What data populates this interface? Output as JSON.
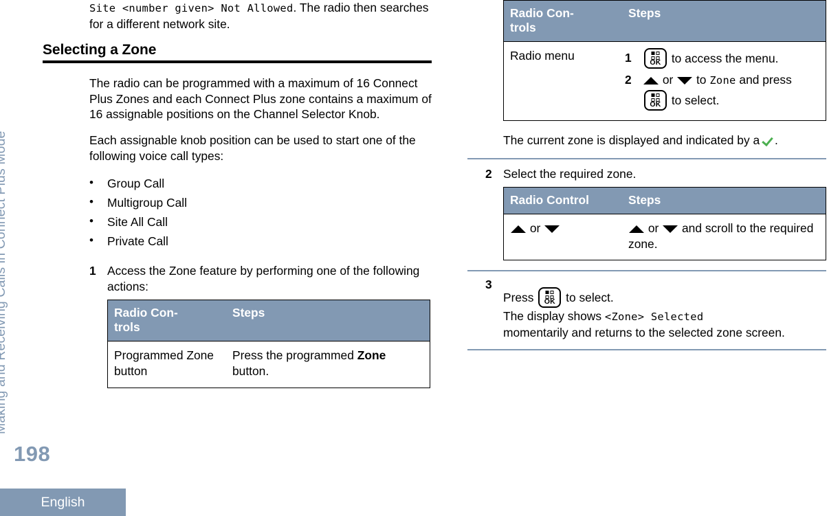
{
  "sidebar": {
    "running_head": "Making and Receiving Calls in Connect Plus Mode",
    "page_number": "198",
    "language_tab": "English"
  },
  "colors": {
    "accent_blue": "#8299b3",
    "table_header_bg": "#8299b3",
    "check_green": "#4caf50",
    "rule_black": "#000000"
  },
  "left_column": {
    "continued_paragraph": {
      "mono_text": "Site <number given> Not Allowed",
      "rest": ". The radio then searches for a different network site."
    },
    "heading": "Selecting a Zone",
    "paragraph_1": "The radio can be programmed with a maximum of 16 Connect Plus Zones and each Connect Plus zone contains a maximum of 16 assignable positions on the Channel Selector Knob.",
    "paragraph_2": "Each assignable knob position can be used to start one of the following voice call types:",
    "call_types": [
      "Group Call",
      "Multigroup Call",
      "Site All Call",
      "Private Call"
    ],
    "step_1": {
      "number": "1",
      "text": "Access the Zone feature by performing one of the following actions:"
    },
    "table_zone_access": {
      "headers": [
        "Radio Con-\ntrols",
        "Steps"
      ],
      "header_col_1": "Radio Con-",
      "header_col_1_line2": "trols",
      "header_col_2": "Steps",
      "rows": [
        {
          "control": "Programmed Zone button",
          "step_prefix": "Press the programmed ",
          "step_bold": "Zone",
          "step_suffix": " button."
        }
      ]
    }
  },
  "right_column": {
    "table_radio_menu": {
      "header_col_1": "Radio Con-",
      "header_col_1_line2": "trols",
      "header_col_2": "Steps",
      "row_control": "Radio menu",
      "substeps": [
        {
          "number": "1",
          "icon": "ok-key-icon",
          "text": " to access the menu."
        },
        {
          "number": "2",
          "text_before": " or ",
          "text_middle": " to ",
          "mono": "Zone",
          "text_after": " and press",
          "text_tail": " to select."
        }
      ]
    },
    "note_after_table": {
      "text_before": "The current zone is displayed and indicated by a ",
      "icon": "green-check-icon",
      "text_after": "."
    },
    "step_2": {
      "number": "2",
      "text": "Select the required zone."
    },
    "table_select_zone": {
      "header_col_1": "Radio Control",
      "header_col_2": "Steps",
      "row_control_or": "or",
      "row_step_or": "or",
      "row_step_text": " and scroll to the required zone."
    },
    "step_3": {
      "number": "3",
      "press_label": "Press ",
      "press_suffix": " to select.",
      "display_prefix": "The display shows ",
      "display_mono": "<Zone> Selected",
      "display_suffix": "momentarily and returns to the selected zone screen."
    }
  }
}
